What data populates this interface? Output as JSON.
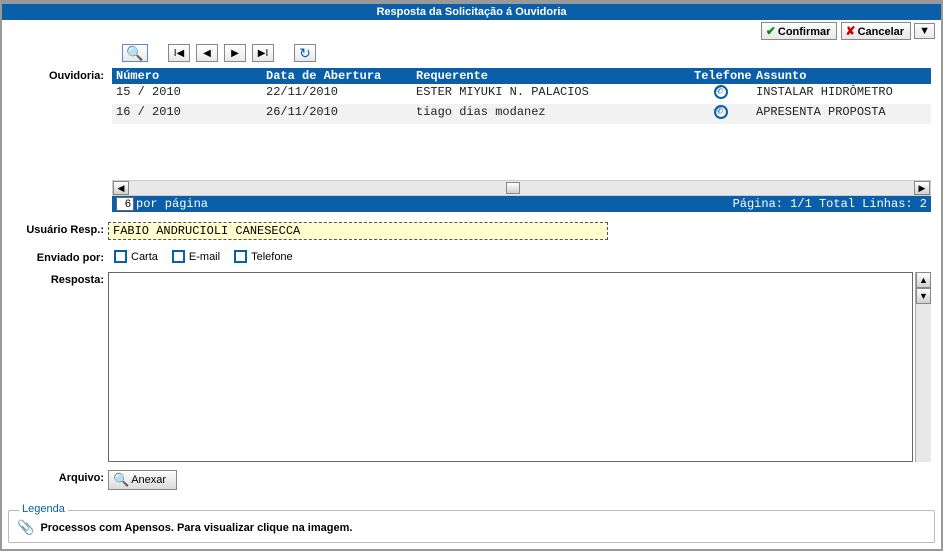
{
  "title": "Resposta da Solicitação á Ouvidoria",
  "actions": {
    "confirm": "Confirmar",
    "cancel": "Cancelar"
  },
  "labels": {
    "ouvidoria": "Ouvidoria:",
    "usuario_resp": "Usuário Resp.:",
    "enviado_por": "Enviado por:",
    "resposta": "Resposta:",
    "arquivo": "Arquivo:"
  },
  "grid": {
    "headers": {
      "numero": "Número",
      "data_abertura": "Data de Abertura",
      "requerente": "Requerente",
      "telefone": "Telefone",
      "assunto": "Assunto"
    },
    "rows": [
      {
        "numero": "15 / 2010",
        "data": "22/11/2010",
        "requerente": "ESTER MIYUKI N. PALACIOS",
        "telefone_icon": true,
        "assunto": "INSTALAR HIDRÔMETRO"
      },
      {
        "numero": "16 / 2010",
        "data": "26/11/2010",
        "requerente": "tiago dias modanez",
        "telefone_icon": true,
        "assunto": "APRESENTA PROPOSTA"
      }
    ],
    "footer": {
      "perpage_value": "6",
      "perpage_label": "por página",
      "right": "Página: 1/1 Total Linhas: 2"
    }
  },
  "usuario_resp_value": "FABIO ANDRUCIOLI CANESECCA",
  "enviado_por_options": {
    "carta": "Carta",
    "email": "E-mail",
    "telefone": "Telefone"
  },
  "resposta_value": "",
  "anexar_label": "Anexar",
  "legend": {
    "title": "Legenda",
    "item": "Processos com Apensos. Para visualizar clique na imagem."
  }
}
